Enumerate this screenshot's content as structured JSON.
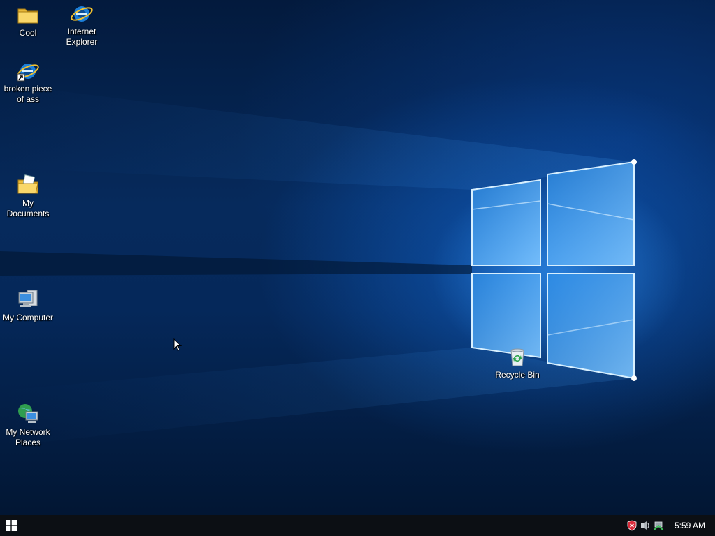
{
  "desktop": {
    "icons": [
      {
        "label": "Cool",
        "icon": "folder-icon"
      },
      {
        "label": "Internet Explorer",
        "icon": "internet-explorer-icon"
      },
      {
        "label": "broken piece of ass",
        "icon": "internet-explorer-shortcut-icon"
      },
      {
        "label": "My Documents",
        "icon": "my-documents-icon"
      },
      {
        "label": "My Computer",
        "icon": "my-computer-icon"
      },
      {
        "label": "My Network Places",
        "icon": "network-places-icon"
      },
      {
        "label": "Recycle Bin",
        "icon": "recycle-bin-icon"
      }
    ]
  },
  "taskbar": {
    "start_icon": "windows-logo-icon",
    "tray_icons": [
      "security-shield-icon",
      "network-speaker-icon",
      "network-status-icon"
    ],
    "clock": "5:59 AM"
  },
  "colors": {
    "taskbar": "#0c0f14",
    "wallpaper_light": "#3aa0ff",
    "wallpaper_dark": "#031a3d"
  }
}
